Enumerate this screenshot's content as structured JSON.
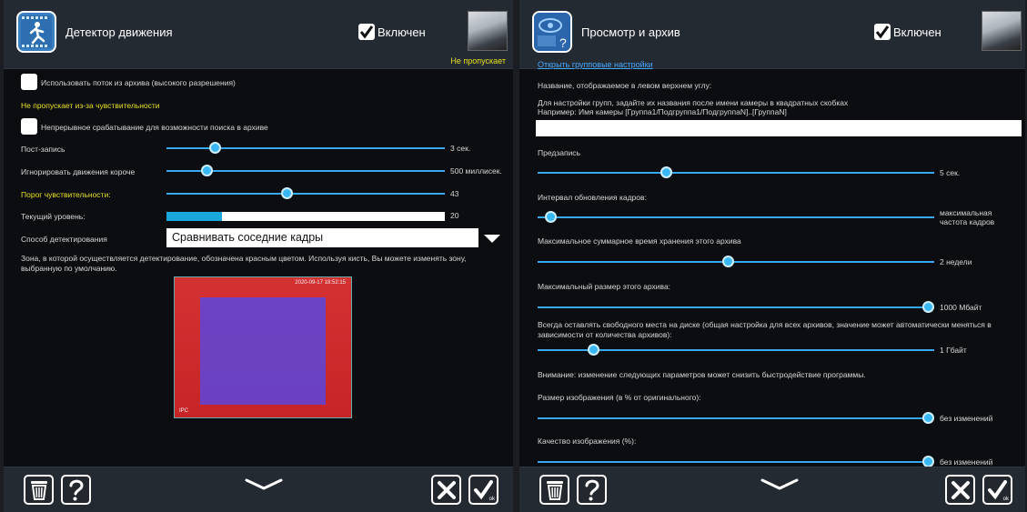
{
  "motion": {
    "title": "Детектор движения",
    "enabled_label": "Включен",
    "status": "Не пропускает",
    "use_archive_stream": "Использовать поток из архива (высокого разрешения)",
    "not_passing_warning": "Не пропускает из-за чувствительности",
    "continuous_trigger": "Непрерывное срабатывание для возможности поиска в архиве",
    "post_record_label": "Пост-запись",
    "post_record_value": "3 сек.",
    "post_record_level": 0.16,
    "ignore_short_label": "Игнорировать движения короче",
    "ignore_short_value": "500 миллисек.",
    "ignore_short_level": 0.13,
    "threshold_label": "Порог чувствительности:",
    "threshold_value": "43",
    "threshold_level": 0.43,
    "current_level_label": "Текущий уровень:",
    "current_level_value": "20",
    "current_level": 0.2,
    "method_label": "Способ детектирования",
    "method_value": "Сравнивать соседние кадры",
    "zone_help": "Зона, в которой осуществляется детектирование, обозначена красным цветом. Используя кисть, Вы можете изменять зону, выбранную по умолчанию.",
    "zone_timestamp": "2020-09-17 18:52:15",
    "zone_cam_label": "IPC"
  },
  "archive": {
    "title": "Просмотр и архив",
    "enabled_label": "Включен",
    "group_link": "Открыть групповые настройки",
    "name_label": "Название, отображаемое в левом верхнем углу:",
    "group_help_1": "Для настройки групп, задайте их названия после имени камеры в квадратных скобках",
    "group_help_2": "Например: Имя камеры [Группа1/Подгруппа1/ПодгруппаN]..[ГруппаN]",
    "name_value": "",
    "prerecord_label": "Предзапись",
    "prerecord_value": "5 сек.",
    "prerecord_level": 0.32,
    "refresh_label": "Интервал обновления кадров:",
    "refresh_value": "максимальная частота кадров",
    "refresh_level": 0.02,
    "retention_label": "Максимальное суммарное время хранения этого архива",
    "retention_value": "2 недели",
    "retention_level": 0.48,
    "max_size_label": "Максимальный размер этого архива:",
    "max_size_value": "1000 Мбайт",
    "max_size_level": 1.0,
    "free_space_label": "Всегда оставлять свободного места на диске (общая настройка для всех архивов, значение может автоматически меняться в зависимости от количества архивов):",
    "free_space_value": "1 Гбайт",
    "free_space_level": 0.13,
    "warning": "Внимание: изменение следующих параметров может снизить быстродействие программы.",
    "image_size_label": "Размер изображения (в % от оригинального):",
    "image_size_value": "без изменений",
    "image_size_level": 1.0,
    "quality_label": "Качество изображения (%):",
    "quality_value": "без изменений",
    "quality_level": 1.0
  },
  "footer": {
    "ok_label": "ok"
  },
  "colors": {
    "accent": "#38a8f0",
    "warning": "#e8e020",
    "link": "#48a8ff",
    "zone_red": "#dc0a0a",
    "zone_blue": "#5a46dc"
  },
  "icons": [
    "motion-detector-icon",
    "camera-archive-icon",
    "trash-icon",
    "help-icon",
    "chevron-down-icon",
    "close-icon",
    "ok-icon"
  ]
}
